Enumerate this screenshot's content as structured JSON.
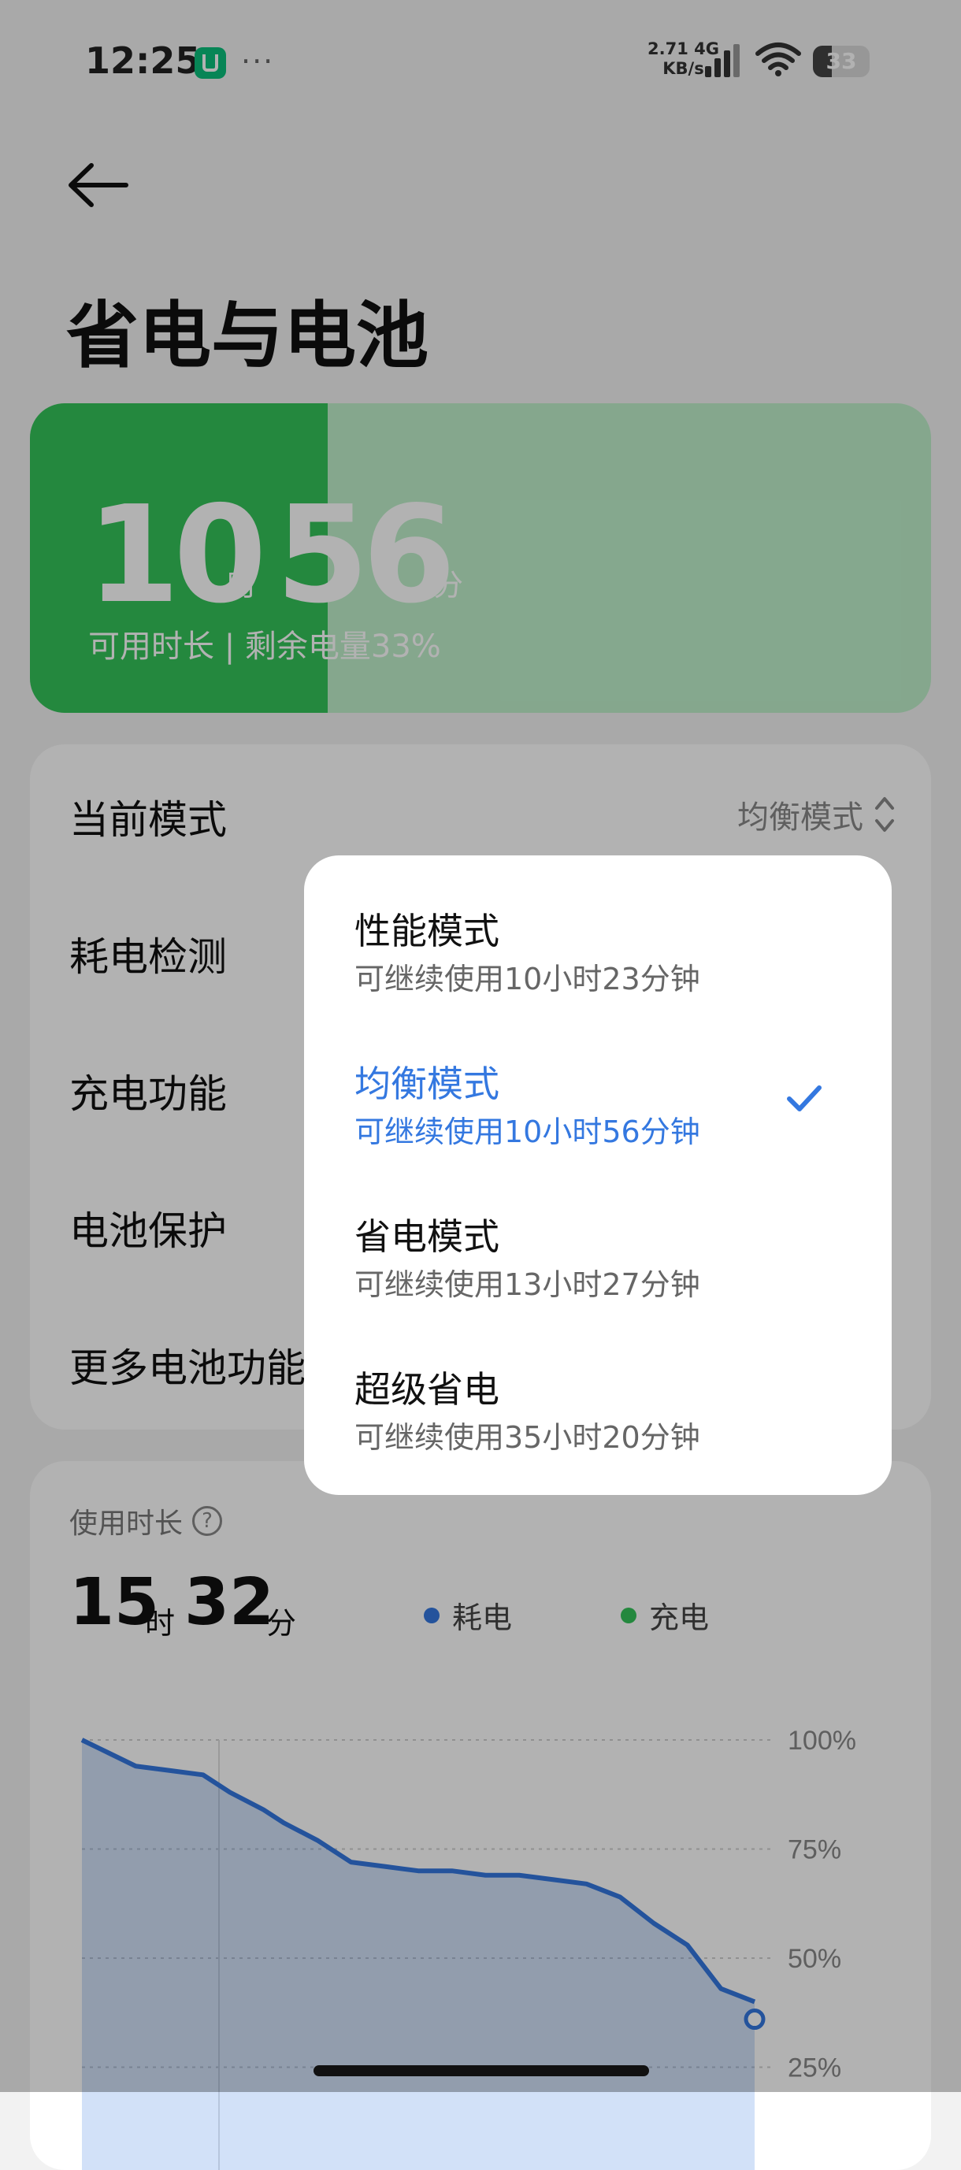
{
  "status_bar": {
    "time": "12:25",
    "app_icon": "mi-home-icon",
    "more": "···",
    "net_speed_value": "2.71",
    "net_speed_unit": "KB/s",
    "network_type": "4G",
    "battery_level": "33",
    "battery_fraction": 0.33
  },
  "header": {
    "back_icon": "arrow-left-icon",
    "title": "省电与电池"
  },
  "battery_card": {
    "hours": "10",
    "hours_unit": "时",
    "minutes": "56",
    "minutes_unit": "分",
    "subtitle": "可用时长 | 剩余电量33%",
    "fill_fraction": 0.33,
    "fill_color": "#34c359",
    "bg_color": "#bff0cb"
  },
  "settings": {
    "current_mode_label": "当前模式",
    "current_mode_value": "均衡模式",
    "rows": [
      {
        "label": "耗电检测"
      },
      {
        "label": "充电功能"
      },
      {
        "label": "电池保护"
      },
      {
        "label": "更多电池功能"
      }
    ]
  },
  "mode_popup": {
    "accent_color": "#3478e0",
    "options": [
      {
        "name": "性能模式",
        "desc": "可继续使用10小时23分钟",
        "selected": false
      },
      {
        "name": "均衡模式",
        "desc": "可继续使用10小时56分钟",
        "selected": true
      },
      {
        "name": "省电模式",
        "desc": "可继续使用13小时27分钟",
        "selected": false
      },
      {
        "name": "超级省电",
        "desc": "可继续使用35小时20分钟",
        "selected": false
      }
    ]
  },
  "usage": {
    "title": "使用时长",
    "help_icon": "question-circle-icon",
    "hours": "15",
    "hours_unit": "时",
    "minutes": "32",
    "minutes_unit": "分",
    "legend": [
      {
        "label": "耗电",
        "color": "#3478e0"
      },
      {
        "label": "充电",
        "color": "#34c359"
      }
    ]
  },
  "chart_data": {
    "type": "area",
    "y_ticks": [
      "100%",
      "75%",
      "50%",
      "25%"
    ],
    "ylim": [
      0,
      100
    ],
    "grid": true,
    "series": [
      {
        "name": "耗电",
        "color": "#3478e0",
        "x": [
          0,
          4,
          8,
          13,
          18,
          22,
          27,
          30,
          35,
          40,
          45,
          50,
          55,
          60,
          65,
          70,
          75,
          80,
          85,
          90,
          95,
          100
        ],
        "values": [
          100,
          97,
          94,
          93,
          92,
          88,
          84,
          81,
          77,
          72,
          71,
          70,
          70,
          69,
          69,
          68,
          67,
          64,
          58,
          53,
          43,
          40
        ]
      }
    ],
    "end_marker_value": 36
  }
}
